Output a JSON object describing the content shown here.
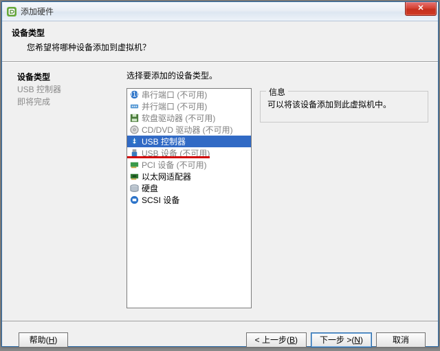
{
  "window": {
    "title": "添加硬件"
  },
  "header": {
    "title": "设备类型",
    "subtitle": "您希望将哪种设备添加到虚拟机？"
  },
  "sidebar": {
    "items": [
      {
        "label": "设备类型",
        "active": true
      },
      {
        "label": "USB 控制器",
        "active": false
      },
      {
        "label": "即将完成",
        "active": false
      }
    ]
  },
  "content": {
    "prompt": "选择要添加的设备类型。",
    "info_legend": "信息",
    "info_body": "可以将该设备添加到此虚拟机中。"
  },
  "devices": [
    {
      "icon": "serial",
      "label": "串行端口 (不可用)",
      "enabled": false,
      "selected": false
    },
    {
      "icon": "parallel",
      "label": "并行端口 (不可用)",
      "enabled": false,
      "selected": false
    },
    {
      "icon": "floppy",
      "label": "软盘驱动器 (不可用)",
      "enabled": false,
      "selected": false
    },
    {
      "icon": "cd",
      "label": "CD/DVD 驱动器 (不可用)",
      "enabled": false,
      "selected": false
    },
    {
      "icon": "usb-ctrl",
      "label": "USB 控制器",
      "enabled": true,
      "selected": true
    },
    {
      "icon": "usb-dev",
      "label": "USB 设备 (不可用)",
      "enabled": false,
      "selected": false
    },
    {
      "icon": "pci",
      "label": "PCI 设备 (不可用)",
      "enabled": false,
      "selected": false
    },
    {
      "icon": "nic",
      "label": "以太网适配器",
      "enabled": true,
      "selected": false
    },
    {
      "icon": "disk",
      "label": "硬盘",
      "enabled": true,
      "selected": false
    },
    {
      "icon": "scsi",
      "label": "SCSI 设备",
      "enabled": true,
      "selected": false
    }
  ],
  "footer": {
    "help_label": "帮助",
    "help_accel": "H",
    "back_label": "< 上一步",
    "back_accel": "B",
    "next_label": "下一步 >",
    "next_accel": "N",
    "cancel_label": "取消"
  }
}
